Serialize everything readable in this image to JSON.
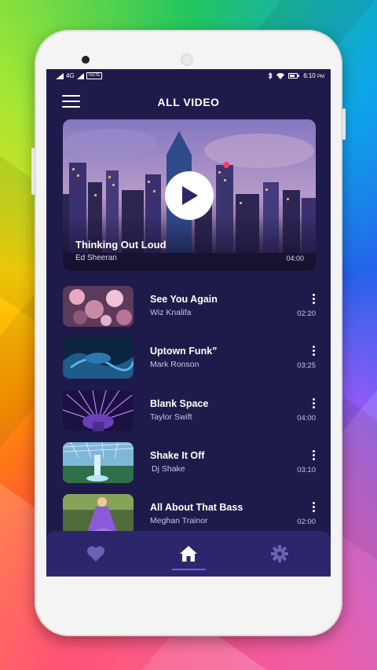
{
  "status_bar": {
    "network": "4G",
    "volte": "VoLTE",
    "time": "6:10",
    "ampm": "PM"
  },
  "header": {
    "title": "ALL VIDEO",
    "menu_icon": "hamburger-menu-icon"
  },
  "featured": {
    "title": "Thinking Out Loud",
    "artist": "Ed Sheeran",
    "duration": "04:00",
    "play_icon": "play-icon"
  },
  "videos": [
    {
      "title": "See You Again",
      "artist": "Wiz Knalifa",
      "duration": "02:20"
    },
    {
      "title": "Uptown Funk”",
      "artist": "Mark Ronson",
      "duration": "03:25"
    },
    {
      "title": "Blank Space",
      "artist": "Taylor Swift",
      "duration": "04:00"
    },
    {
      "title": "Shake It Off",
      "artist": "Dj Shake",
      "duration": "03:10"
    },
    {
      "title": "All About That Bass",
      "artist": "Meghan Trainor",
      "duration": "02:00"
    }
  ],
  "bottom_nav": {
    "items": [
      {
        "icon": "heart-icon",
        "active": false
      },
      {
        "icon": "home-icon",
        "active": true
      },
      {
        "icon": "gear-icon",
        "active": false
      }
    ]
  },
  "colors": {
    "screen_bg": "#1e1b4b",
    "nav_bg": "#2b276a",
    "accent": "#6b5cff",
    "inactive_icon": "#6a63b3"
  }
}
